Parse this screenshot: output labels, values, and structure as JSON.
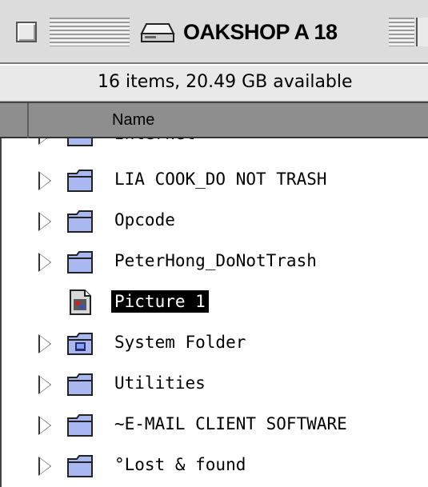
{
  "window": {
    "title": "OAKSHOP A 18",
    "info": "16 items, 20.49 GB available",
    "column_header": "Name"
  },
  "rows": [
    {
      "name": "Internet",
      "icon": "folder-icon",
      "expandable": true,
      "selected": false
    },
    {
      "name": "LIA COOK_DO NOT TRASH",
      "icon": "folder-icon",
      "expandable": true,
      "selected": false
    },
    {
      "name": "Opcode",
      "icon": "folder-icon",
      "expandable": true,
      "selected": false
    },
    {
      "name": "PeterHong_DoNotTrash",
      "icon": "folder-icon",
      "expandable": true,
      "selected": false
    },
    {
      "name": "Picture 1",
      "icon": "picture-file-icon",
      "expandable": false,
      "selected": true
    },
    {
      "name": "System Folder",
      "icon": "system-folder-icon",
      "expandable": true,
      "selected": false
    },
    {
      "name": "Utilities",
      "icon": "folder-icon",
      "expandable": true,
      "selected": false
    },
    {
      "name": "~E-MAIL CLIENT SOFTWARE",
      "icon": "folder-icon",
      "expandable": true,
      "selected": false
    },
    {
      "name": "°Lost & found",
      "icon": "folder-icon",
      "expandable": true,
      "selected": false
    }
  ],
  "colors": {
    "titlebar": "#dcdcdc",
    "header": "#8e8e8e",
    "folder": "#a9b8f0",
    "selection": "#000000"
  }
}
